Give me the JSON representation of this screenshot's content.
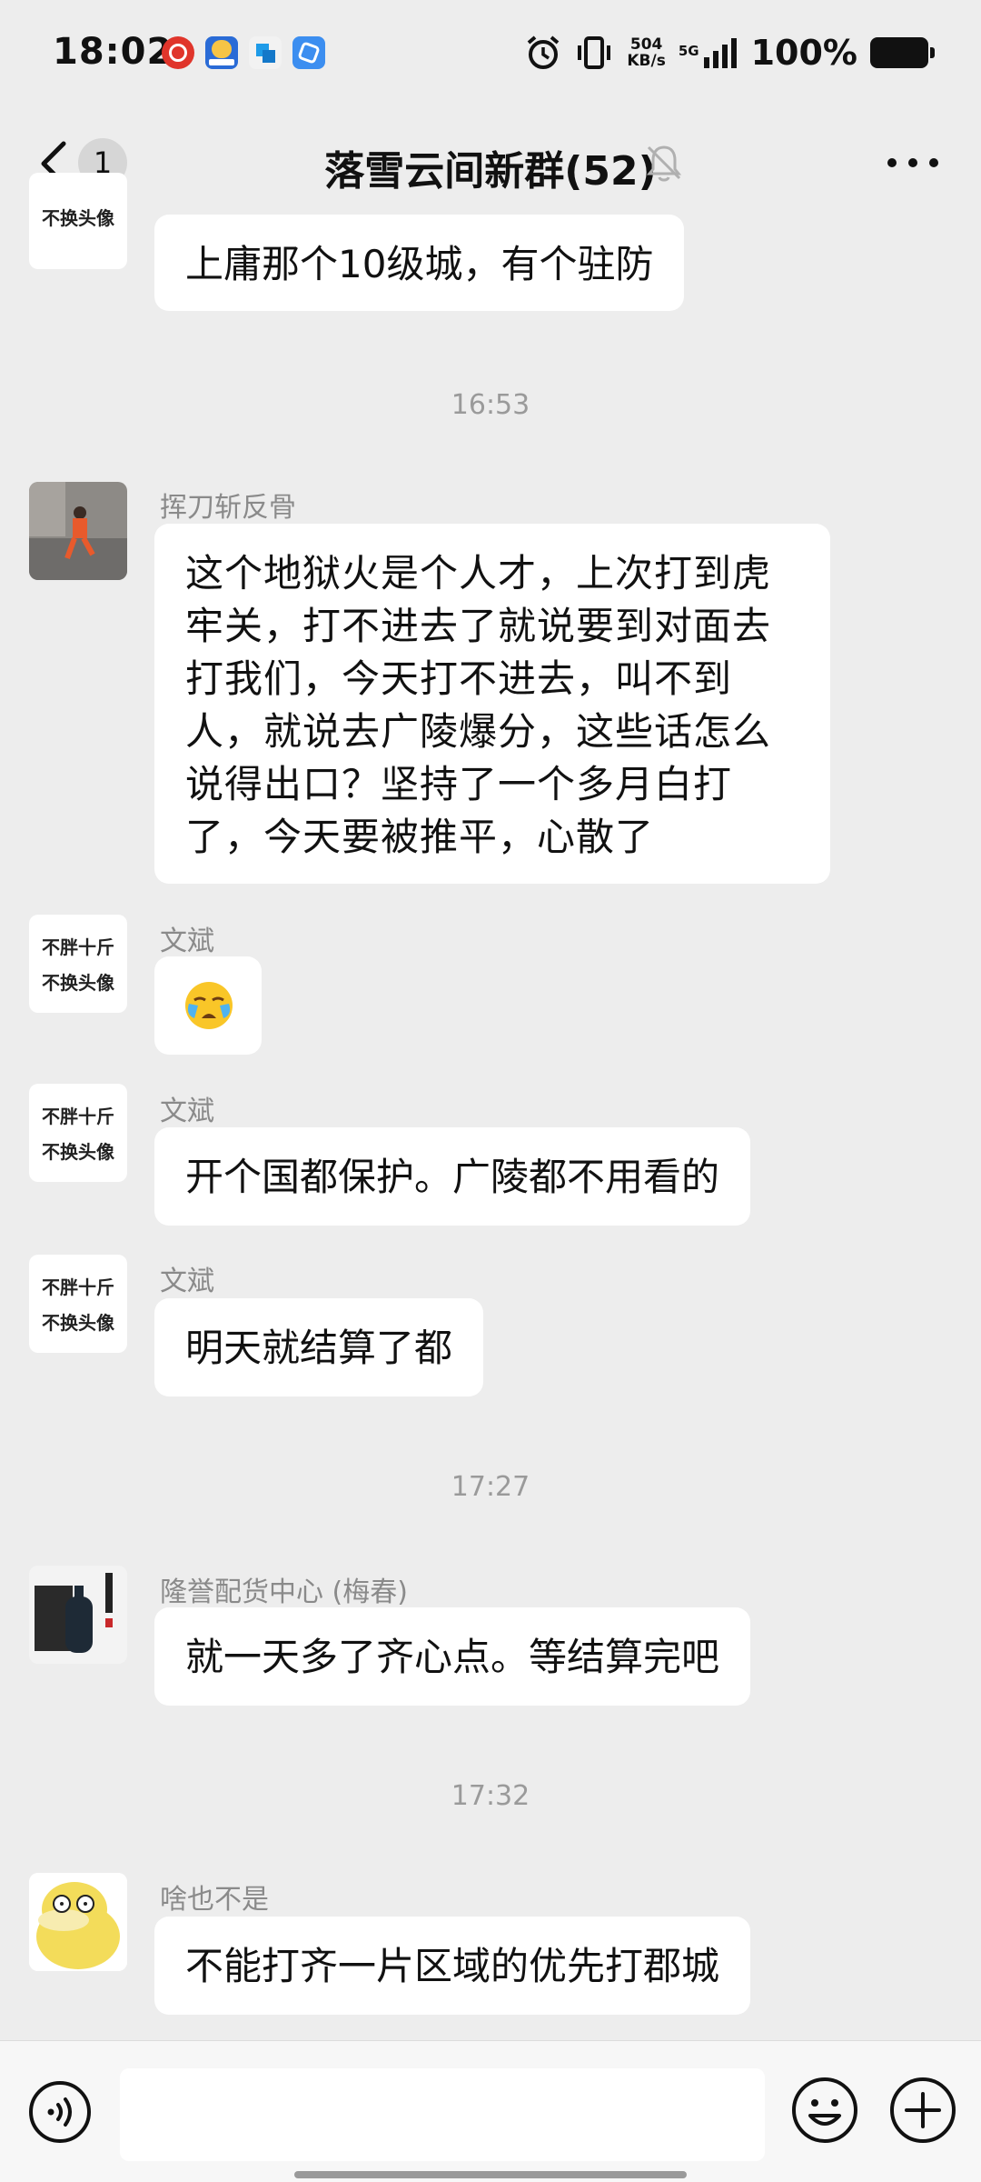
{
  "status": {
    "time": "18:02",
    "net_speed_value": "504",
    "net_speed_unit": "KB/s",
    "network": "5G",
    "battery": "100%"
  },
  "header": {
    "title": "落雪云间新群(52)",
    "unread_count": "1"
  },
  "messages": [
    {
      "avatar_lines": [
        "不换头像"
      ],
      "sender": "",
      "text": "上庸那个10级城，有个驻防"
    },
    {
      "sender": "挥刀斩反骨",
      "text": "这个地狱火是个人才，上次打到虎牢关，打不进去了就说要到对面去打我们，今天打不进去，叫不到人，就说去广陵爆分，这些话怎么说得出口？坚持了一个多月白打了，今天要被推平，心散了"
    },
    {
      "avatar_lines": [
        "不胖十斤",
        "不换头像"
      ],
      "sender": "文斌",
      "text": ""
    },
    {
      "avatar_lines": [
        "不胖十斤",
        "不换头像"
      ],
      "sender": "文斌",
      "text": "开个国都保护。广陵都不用看的"
    },
    {
      "avatar_lines": [
        "不胖十斤",
        "不换头像"
      ],
      "sender": "文斌",
      "text": "明天就结算了都"
    },
    {
      "sender": "隆誉配货中心 (梅春)",
      "text": "就一天多了齐心点。等结算完吧"
    },
    {
      "sender": "啥也不是",
      "text": "不能打齐一片区域的优先打郡城"
    }
  ],
  "timestamps": [
    "16:53",
    "17:27",
    "17:32"
  ],
  "input": {
    "value": "",
    "placeholder": ""
  },
  "icons": {
    "back": "chevron-left-icon",
    "mute": "bell-off-icon",
    "more": "more-horizontal-icon",
    "voice": "voice-icon",
    "emoji": "emoji-icon",
    "plus": "plus-icon",
    "emoji_message": "crying-face-emoji"
  },
  "colors": {
    "background": "#ededed",
    "bubble": "#ffffff",
    "timestamp": "#9a9a9a"
  }
}
